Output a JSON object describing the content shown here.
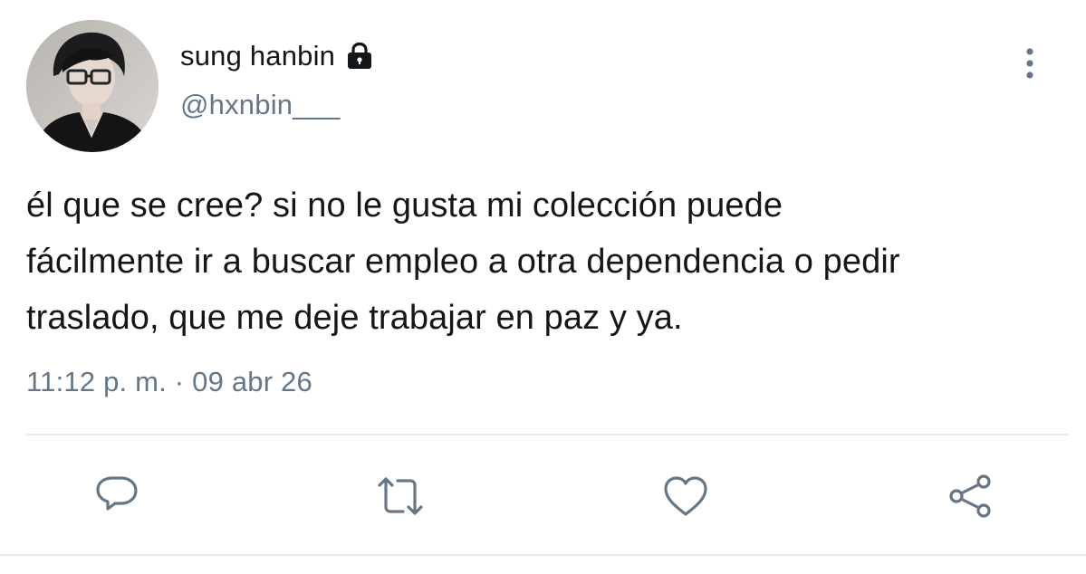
{
  "author": {
    "display_name": "sung hanbin",
    "handle": "@hxnbin___",
    "protected_icon": "lock-icon",
    "avatar_icon": "profile-photo"
  },
  "tweet": {
    "text": "él que se cree? si no le gusta mi colección puede\nfácilmente ir a buscar empleo a otra dependencia o pedir\ntraslado, que me deje trabajar en paz y ya.",
    "timestamp": "11:12 p. m. · 09 abr 26"
  },
  "actions": [
    {
      "name": "reply",
      "icon": "reply-icon"
    },
    {
      "name": "retweet",
      "icon": "retweet-icon"
    },
    {
      "name": "like",
      "icon": "heart-icon"
    },
    {
      "name": "share",
      "icon": "share-icon"
    }
  ],
  "menu_icon": "more-vertical-icon",
  "colors": {
    "text": "#14171a",
    "secondary": "#657786",
    "icon": "#657786",
    "divider": "#e6ecf0",
    "background": "#ffffff"
  }
}
